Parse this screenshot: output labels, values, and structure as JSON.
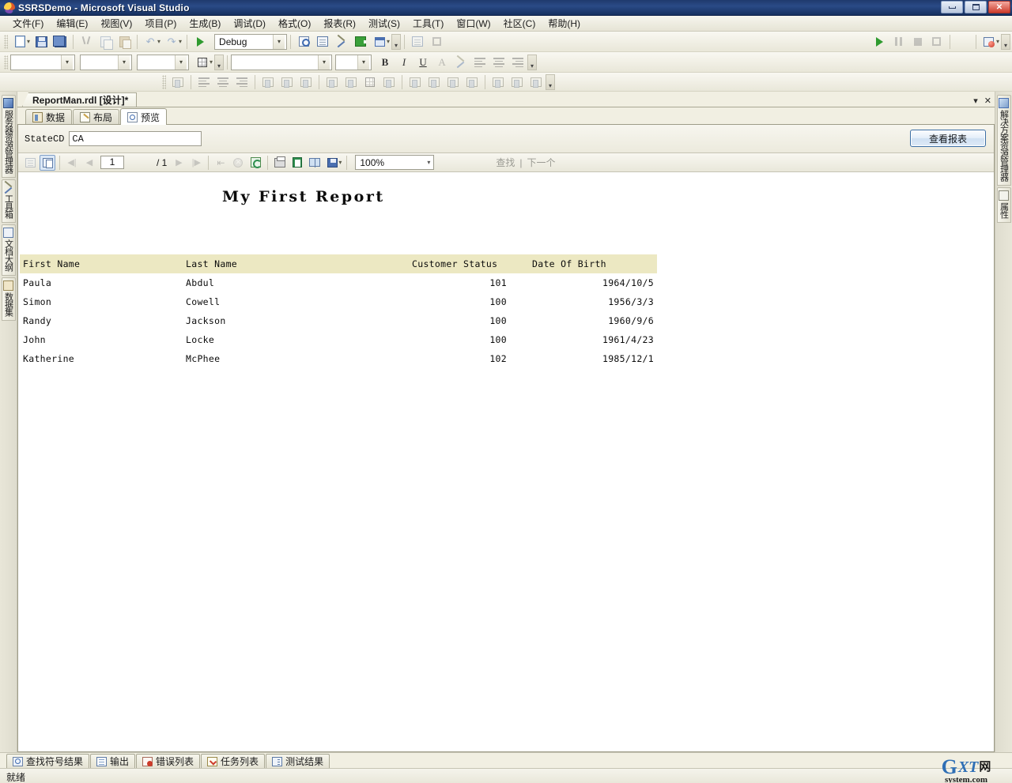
{
  "window": {
    "title": "SSRSDemo - Microsoft Visual Studio",
    "minimize_label": "",
    "maximize_label": "",
    "close_label": "✕"
  },
  "menu": {
    "items": [
      "文件(F)",
      "编辑(E)",
      "视图(V)",
      "项目(P)",
      "生成(B)",
      "调试(D)",
      "格式(O)",
      "报表(R)",
      "测试(S)",
      "工具(T)",
      "窗口(W)",
      "社区(C)",
      "帮助(H)"
    ]
  },
  "toolbar": {
    "config_value": "Debug",
    "format_combo1": "",
    "format_combo2": "",
    "format_combo3": "",
    "font_name": "",
    "font_size": "",
    "bold_label": "B",
    "italic_label": "I",
    "underline_label": "U",
    "fontcolor_label": "A",
    "overflow_label": "»"
  },
  "document": {
    "tab_title": "ReportMan.rdl [设计]*",
    "tab_dropdown": "▾",
    "tab_close": "✕",
    "subtabs": [
      {
        "label": "数据",
        "icon": "data-icon",
        "active": false
      },
      {
        "label": "布局",
        "icon": "layout-icon",
        "active": false
      },
      {
        "label": "预览",
        "icon": "preview-icon",
        "active": true
      }
    ]
  },
  "parameters": {
    "state_label": "StateCD",
    "state_value": "CA",
    "state_placeholder": "",
    "view_report_button": "查看报表"
  },
  "viewer_toolbar": {
    "page_current": "1",
    "page_total": "/ 1",
    "zoom_value": "100%",
    "zoom_arrow": "▾",
    "find_label": "查找",
    "find_separator": "|",
    "next_label": "下一个",
    "first_page": "⏮",
    "prev_page": "◀",
    "next_page": "▶",
    "last_page": "⏭",
    "back_label": "⇤",
    "stop_label": "✕"
  },
  "report": {
    "title": "My First Report",
    "columns": [
      "First Name",
      "Last Name",
      "Customer Status",
      "Date Of Birth"
    ],
    "rows": [
      {
        "first_name": "Paula",
        "last_name": "Abdul",
        "status": "101",
        "dob": "1964/10/5"
      },
      {
        "first_name": "Simon",
        "last_name": "Cowell",
        "status": "100",
        "dob": "1956/3/3"
      },
      {
        "first_name": "Randy",
        "last_name": "Jackson",
        "status": "100",
        "dob": "1960/9/6"
      },
      {
        "first_name": "John",
        "last_name": "Locke",
        "status": "100",
        "dob": "1961/4/23"
      },
      {
        "first_name": "Katherine",
        "last_name": "McPhee",
        "status": "102",
        "dob": "1985/12/1"
      }
    ],
    "header_bg": "#ece8c2"
  },
  "left_strip": {
    "items": [
      {
        "label": "服务器资源管理器",
        "icon": "server-explorer-icon"
      },
      {
        "label": "工具箱",
        "icon": "toolbox-icon"
      },
      {
        "label": "文档大纲",
        "icon": "document-outline-icon"
      },
      {
        "label": "数据集",
        "icon": "dataset-icon"
      }
    ]
  },
  "right_strip": {
    "items": [
      {
        "label": "解决方案资源管理器",
        "icon": "solution-explorer-icon"
      },
      {
        "label": "属性",
        "icon": "properties-icon"
      }
    ]
  },
  "bottom_tabs": {
    "items": [
      {
        "label": "查找符号结果",
        "icon": "find-symbol-icon"
      },
      {
        "label": "输出",
        "icon": "output-icon"
      },
      {
        "label": "错误列表",
        "icon": "error-list-icon"
      },
      {
        "label": "任务列表",
        "icon": "task-list-icon"
      },
      {
        "label": "测试结果",
        "icon": "test-results-icon"
      }
    ]
  },
  "status": {
    "text": "就绪"
  },
  "watermark": {
    "g": "G",
    "xt": "XT",
    "cn": "网",
    "domain": "system.com"
  }
}
